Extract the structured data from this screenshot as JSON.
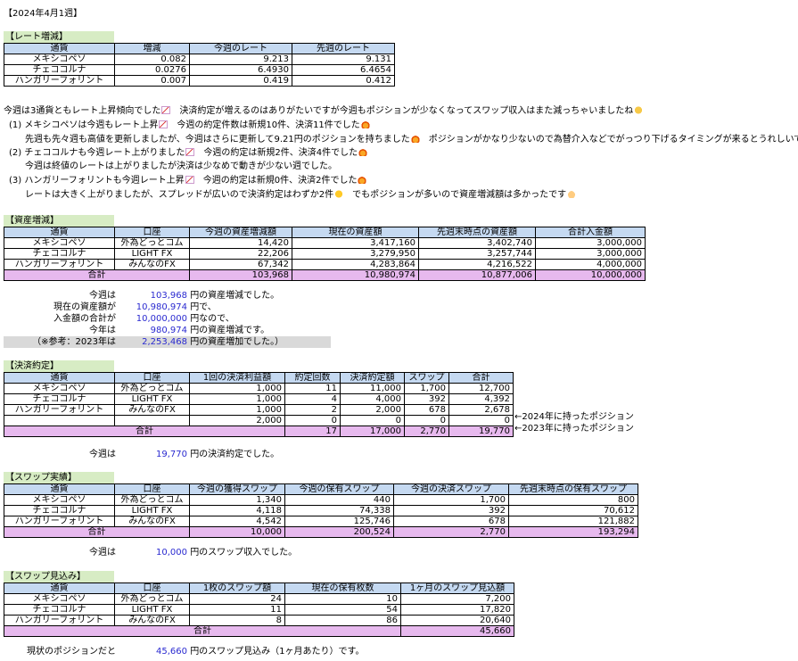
{
  "page_title": "【2024年4月1週】",
  "rate": {
    "header": "【レート増減】",
    "columns": [
      "通貨",
      "増減",
      "今週のレート",
      "先週のレート"
    ],
    "rows": [
      [
        "メキシコペソ",
        "0.082",
        "9.213",
        "9.131"
      ],
      [
        "チェココルナ",
        "0.0276",
        "6.4930",
        "6.4654"
      ],
      [
        "ハンガリーフォリント",
        "0.007",
        "0.419",
        "0.412"
      ]
    ]
  },
  "comments": {
    "line1": "今週は3通貨ともレート上昇傾向でした",
    "line1b": "　決済約定が増えるのはありがたいですが今週もポジションが少なくなってスワップ収入はまた減っちゃいましたね",
    "line2": "(1)  メキシコペソは今週もレート上昇",
    "line2b": "　今週の約定件数は新規10件、決済11件でした",
    "line3": "先週も先々週も高値を更新しましたが、今週はさらに更新して9.21円のポジションを持ちました",
    "line3b": "　ポジションがかなり少ないので為替介入などでがっつり下げるタイミングが来るとうれしいです",
    "line4": "(2)  チェココルナも今週レート上がりました",
    "line4b": "　今週の約定は新規2件、決済4件でした",
    "line5": "今週は終値のレートは上がりましたが決済は少なめで動きが少ない週でした。",
    "line6": "(3)  ハンガリーフォリントも今週レート上昇",
    "line6b": "　今週の約定は新規0件、決済2件でした",
    "line7": "レートは大きく上がりましたが、スプレッドが広いので決済約定はわずか2件",
    "line7b": "　でもポジションが多いので資産増減額は多かったです"
  },
  "assets": {
    "header": "【資産増減】",
    "columns": [
      "通貨",
      "口座",
      "今週の資産増減額",
      "現在の資産額",
      "先週末時点の資産額",
      "合計入金額"
    ],
    "rows": [
      [
        "メキシコペソ",
        "外為どっとコム",
        "14,420",
        "3,417,160",
        "3,402,740",
        "3,000,000"
      ],
      [
        "チェココルナ",
        "LIGHT FX",
        "22,206",
        "3,279,950",
        "3,257,744",
        "3,000,000"
      ],
      [
        "ハンガリーフォリント",
        "みんなのFX",
        "67,342",
        "4,283,864",
        "4,216,522",
        "4,000,000"
      ]
    ],
    "total": [
      "合計",
      "103,968",
      "10,980,974",
      "10,877,006",
      "10,000,000"
    ],
    "summary": [
      {
        "label": "今週は",
        "value": "103,968",
        "suffix": "円の資産増減でした。"
      },
      {
        "label": "現在の資産額が",
        "value": "10,980,974",
        "suffix": "円で、"
      },
      {
        "label": "入金額の合計が",
        "value": "10,000,000",
        "suffix": "円なので、"
      },
      {
        "label": "今年は",
        "value": "980,974",
        "suffix": "円の資産増減です。"
      },
      {
        "label": "（※参考：2023年は",
        "value": "2,253,468",
        "suffix": "円の資産増加でした。）"
      }
    ]
  },
  "settle": {
    "header": "【決済約定】",
    "columns": [
      "通貨",
      "口座",
      "1回の決済利益額",
      "約定回数",
      "決済約定額",
      "スワップ",
      "合計"
    ],
    "rows": [
      [
        "メキシコペソ",
        "外為どっとコム",
        "1,000",
        "11",
        "11,000",
        "1,700",
        "12,700"
      ],
      [
        "チェココルナ",
        "LIGHT FX",
        "1,000",
        "4",
        "4,000",
        "392",
        "4,392"
      ],
      [
        "ハンガリーフォリント",
        "みんなのFX",
        "1,000",
        "2",
        "2,000",
        "678",
        "2,678"
      ],
      [
        "",
        "",
        "2,000",
        "0",
        "0",
        "0",
        "0"
      ]
    ],
    "total": [
      "合計",
      "17",
      "17,000",
      "2,770",
      "19,770"
    ],
    "notes": [
      "←2024年に持ったポジション",
      "←2023年に持ったポジション"
    ],
    "summary": {
      "label": "今週は",
      "value": "19,770",
      "suffix": "円の決済約定でした。"
    }
  },
  "swap": {
    "header": "【スワップ実績】",
    "columns": [
      "通貨",
      "口座",
      "今週の獲得スワップ",
      "今週の保有スワップ",
      "今週の決済スワップ",
      "先週末時点の保有スワップ"
    ],
    "rows": [
      [
        "メキシコペソ",
        "外為どっとコム",
        "1,340",
        "440",
        "1,700",
        "800"
      ],
      [
        "チェココルナ",
        "LIGHT FX",
        "4,118",
        "74,338",
        "392",
        "70,612"
      ],
      [
        "ハンガリーフォリント",
        "みんなのFX",
        "4,542",
        "125,746",
        "678",
        "121,882"
      ]
    ],
    "total": [
      "合計",
      "10,000",
      "200,524",
      "2,770",
      "193,294"
    ],
    "summary": {
      "label": "今週は",
      "value": "10,000",
      "suffix": "円のスワップ収入でした。"
    }
  },
  "forecast": {
    "header": "【スワップ見込み】",
    "columns": [
      "通貨",
      "口座",
      "1枚のスワップ額",
      "現在の保有枚数",
      "1ヶ月のスワップ見込額"
    ],
    "rows": [
      [
        "メキシコペソ",
        "外為どっとコム",
        "24",
        "10",
        "7,200"
      ],
      [
        "チェココルナ",
        "LIGHT FX",
        "11",
        "54",
        "17,820"
      ],
      [
        "ハンガリーフォリント",
        "みんなのFX",
        "8",
        "86",
        "20,640"
      ]
    ],
    "total": [
      "合計",
      "45,660"
    ],
    "summary": {
      "label": "現状のポジションだと",
      "value": "45,660",
      "suffix": "円のスワップ見込み（1ヶ月あたり）です。"
    }
  }
}
